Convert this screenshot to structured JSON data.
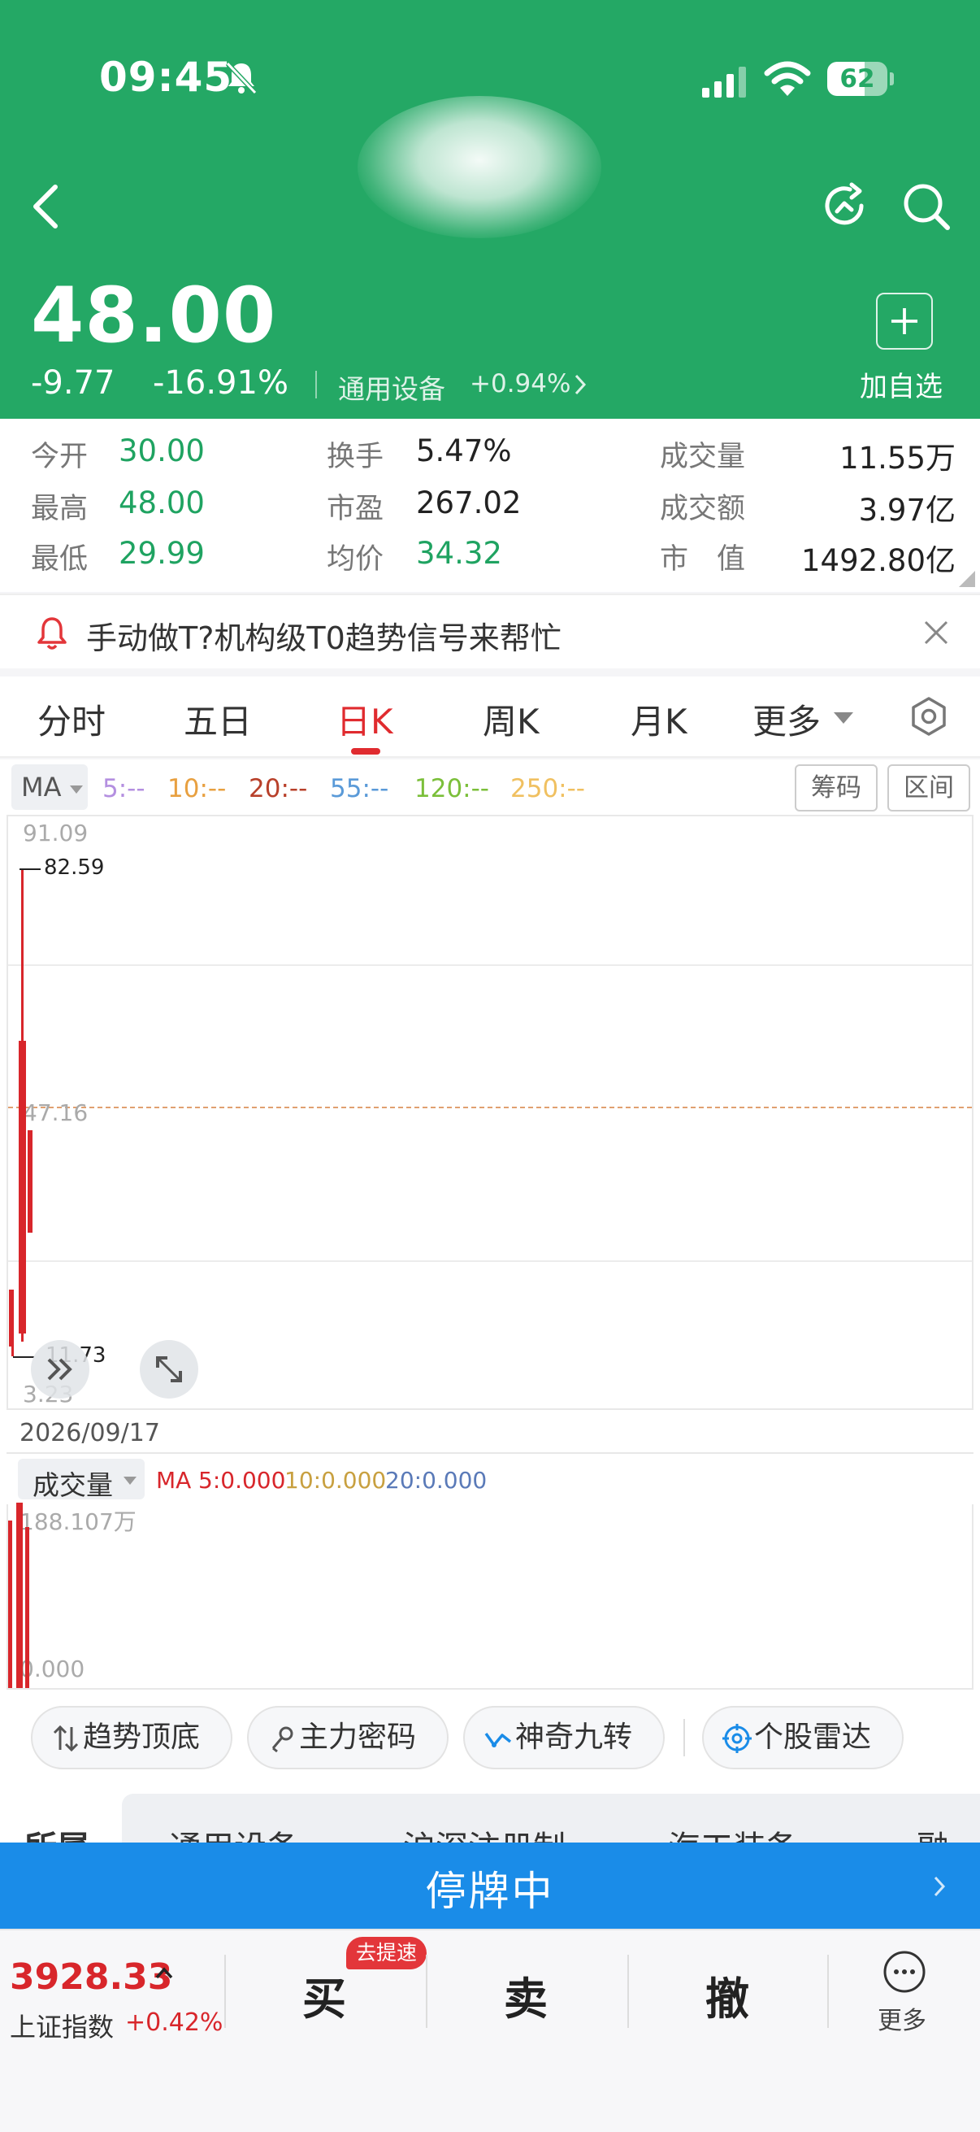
{
  "status_bar": {
    "time": "09:45",
    "battery": "62",
    "battery_level": 0.62
  },
  "header": {
    "price": "48.00",
    "change": "-9.77",
    "change_pct": "-16.91%",
    "sector": "通用设备",
    "sector_change": "+0.94%",
    "add_watch_label": "加自选",
    "bg_color": "#24a865"
  },
  "quote": {
    "open_label": "今开",
    "open": "30.00",
    "high_label": "最高",
    "high": "48.00",
    "low_label": "最低",
    "low": "29.99",
    "turnover_label": "换手",
    "turnover": "5.47%",
    "pe_label": "市盈",
    "pe": "267.02",
    "avg_label": "均价",
    "avg": "34.32",
    "volume_label": "成交量",
    "volume": "11.55万",
    "amount_label": "成交额",
    "amount": "3.97亿",
    "mcap_label": "市　值",
    "mcap": "1492.80亿"
  },
  "promo": {
    "text": "手动做T?机构级T0趋势信号来帮忙"
  },
  "tabs": [
    {
      "label": "分时"
    },
    {
      "label": "五日"
    },
    {
      "label": "日K",
      "active": true
    },
    {
      "label": "周K"
    },
    {
      "label": "月K"
    },
    {
      "label": "更多"
    }
  ],
  "ma_bar": {
    "button": "MA",
    "legend": [
      {
        "label": "5:--",
        "color": "#b48fe0"
      },
      {
        "label": "10:--",
        "color": "#e8a040"
      },
      {
        "label": "20:--",
        "color": "#b8402a"
      },
      {
        "label": "55:--",
        "color": "#5a9ad8"
      },
      {
        "label": "120:--",
        "color": "#7bbf3a"
      },
      {
        "label": "250:--",
        "color": "#f0c060"
      }
    ],
    "chip_button": "筹码",
    "range_button": "区间"
  },
  "kline": {
    "axis_top": "91.09",
    "axis_mid": "47.16",
    "axis_bottom": "3.23",
    "high_mark": "82.59",
    "low_mark": "11.73",
    "date": "2026/09/17"
  },
  "volume_panel": {
    "button": "成交量",
    "ma_label": "MA",
    "legend": [
      {
        "label": "5:0.000",
        "color": "#d8262b"
      },
      {
        "label": "10:0.000",
        "color": "#c8a040"
      },
      {
        "label": "20:0.000",
        "color": "#5a7ab8"
      }
    ],
    "axis_top": "188.107万",
    "axis_bottom": "0.000"
  },
  "features": [
    {
      "label": "趋势顶底",
      "icon": "trend-arrows-icon"
    },
    {
      "label": "主力密码",
      "icon": "key-icon"
    },
    {
      "label": "神奇九转",
      "icon": "wave-icon"
    },
    {
      "label": "个股雷达",
      "icon": "radar-icon"
    }
  ],
  "industry": {
    "heading": "所属",
    "items": [
      "通用设备",
      "沪深注册制",
      "海工装备",
      "融资"
    ]
  },
  "halt_bar": {
    "text": "停牌中",
    "color": "#1a8ce8"
  },
  "bottom_bar": {
    "index_value": "3928.33",
    "index_name": "上证指数",
    "index_change": "+0.42%",
    "buy": "买",
    "buy_badge": "去提速",
    "sell": "卖",
    "cancel": "撤",
    "more": "更多"
  }
}
